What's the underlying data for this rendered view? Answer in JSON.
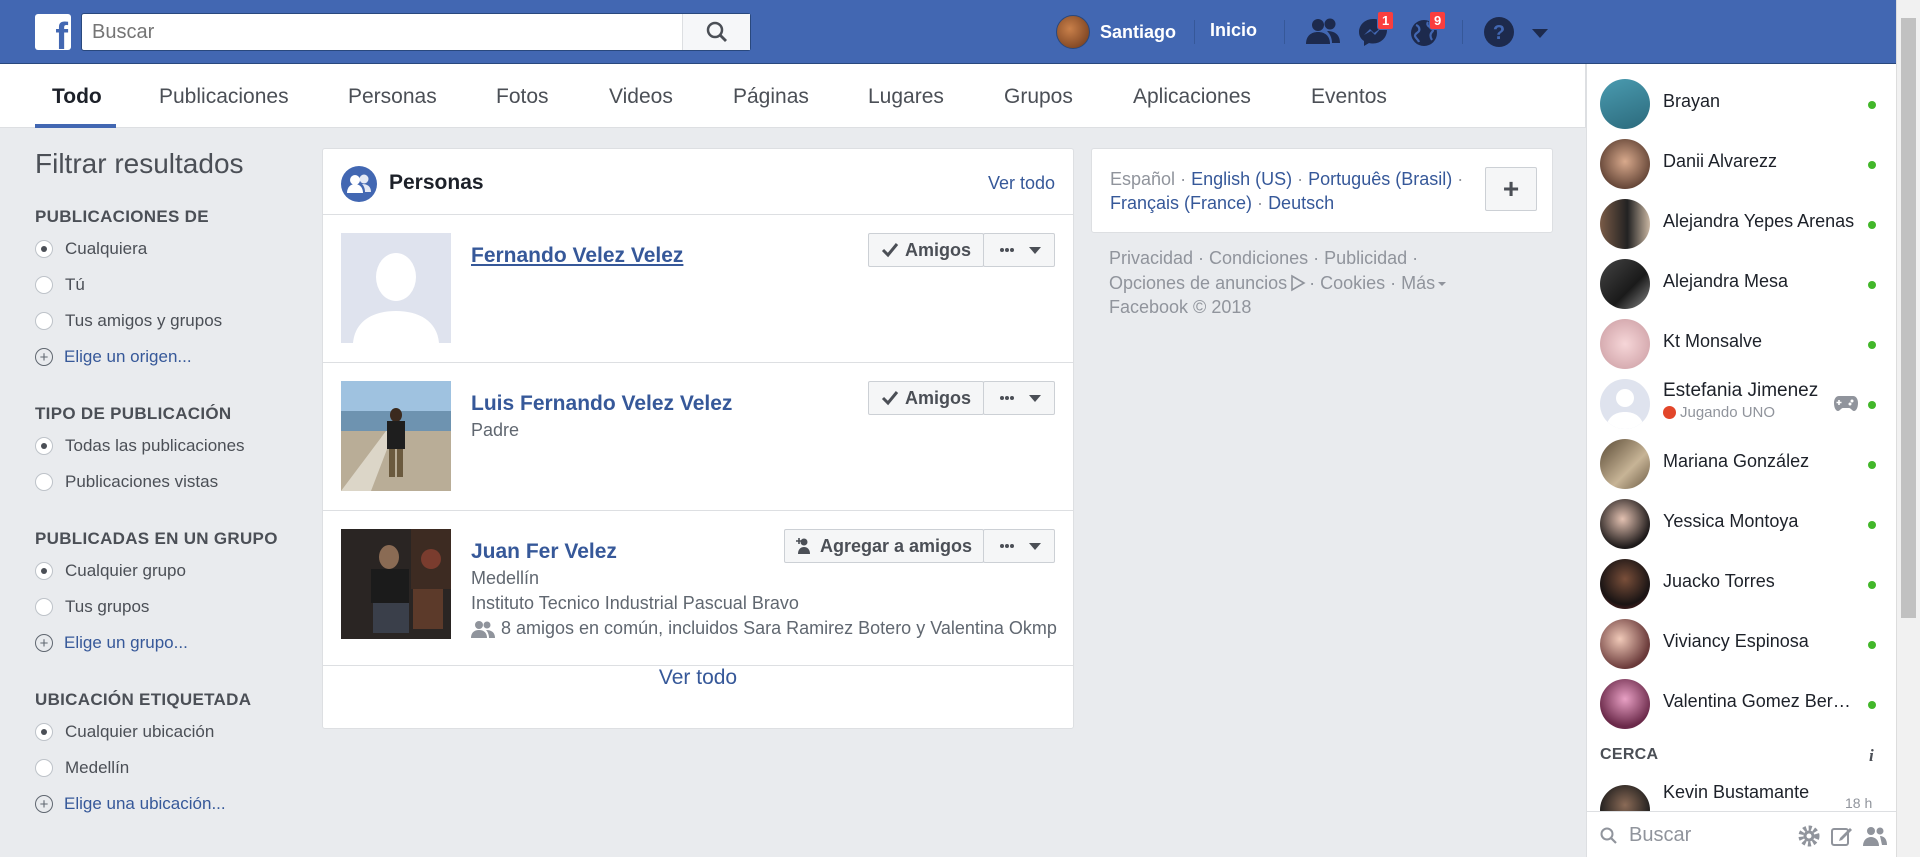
{
  "header": {
    "search_placeholder": "Buscar",
    "user_name": "Santiago",
    "home_label": "Inicio",
    "messages_count": "1",
    "notifications_count": "9",
    "accent": "#4267b2"
  },
  "tabs": [
    {
      "label": "Todo"
    },
    {
      "label": "Publicaciones"
    },
    {
      "label": "Personas"
    },
    {
      "label": "Fotos"
    },
    {
      "label": "Videos"
    },
    {
      "label": "Páginas"
    },
    {
      "label": "Lugares"
    },
    {
      "label": "Grupos"
    },
    {
      "label": "Aplicaciones"
    },
    {
      "label": "Eventos"
    }
  ],
  "filters": {
    "title": "Filtrar resultados",
    "sections": [
      {
        "heading": "PUBLICACIONES DE",
        "options": [
          "Cualquiera",
          "Tú",
          "Tus amigos y grupos"
        ],
        "link": "Elige un origen..."
      },
      {
        "heading": "TIPO DE PUBLICACIÓN",
        "options": [
          "Todas las publicaciones",
          "Publicaciones vistas"
        ]
      },
      {
        "heading": "PUBLICADAS EN UN GRUPO",
        "options": [
          "Cualquier grupo",
          "Tus grupos"
        ],
        "link": "Elige un grupo..."
      },
      {
        "heading": "UBICACIÓN ETIQUETADA",
        "options": [
          "Cualquier ubicación",
          "Medellín"
        ],
        "link": "Elige una ubicación..."
      }
    ]
  },
  "people": {
    "title": "Personas",
    "see_all": "Ver todo",
    "footer_link": "Ver todo",
    "results": [
      {
        "name": "Fernando Velez Velez",
        "action": "Amigos"
      },
      {
        "name": "Luis Fernando Velez Velez",
        "subtitle": "Padre",
        "action": "Amigos"
      },
      {
        "name": "Juan Fer Velez",
        "subtitle": "Medellín",
        "detail": "Instituto Tecnico Industrial Pascual Bravo",
        "mutual": "8 amigos en común, incluidos Sara Ramirez Botero y Valentina Okmp",
        "action": "Agregar a amigos"
      }
    ]
  },
  "languages": {
    "current": "Español",
    "links": [
      "English (US)",
      "Português (Brasil)",
      "Français (France)",
      "Deutsch"
    ],
    "sep": "·"
  },
  "legal": {
    "line1": "Privacidad · Condiciones · Publicidad ·",
    "line2_a": "Opciones de anuncios",
    "line2_b": "· Cookies · Más",
    "copyright": "Facebook © 2018"
  },
  "chat": {
    "contacts": [
      {
        "name": "Brayan"
      },
      {
        "name": "Danii Alvarezz"
      },
      {
        "name": "Alejandra Yepes Arenas"
      },
      {
        "name": "Alejandra Mesa"
      },
      {
        "name": "Kt Monsalve"
      },
      {
        "name": "Estefania Jimenez",
        "status": "Jugando UNO"
      },
      {
        "name": "Mariana González"
      },
      {
        "name": "Yessica Montoya"
      },
      {
        "name": "Juacko Torres"
      },
      {
        "name": "Viviancy Espinosa"
      },
      {
        "name": "Valentina Gomez Bermudez"
      }
    ],
    "nearby_heading": "CERCA",
    "nearby": [
      {
        "name": "Kevin Bustamante",
        "time": "18 h"
      }
    ],
    "search_placeholder": "Buscar"
  }
}
